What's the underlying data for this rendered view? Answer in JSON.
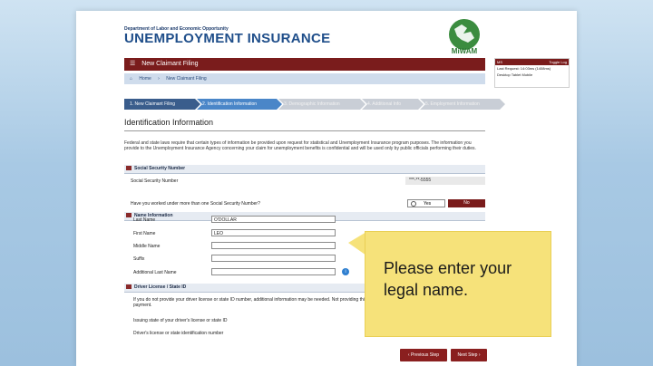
{
  "header": {
    "department": "Department of Labor and Economic Opportunity",
    "title": "UNEMPLOYMENT INSURANCE",
    "logo_text": "MiWAM"
  },
  "filing_bar": {
    "label": "New Claimant Filing"
  },
  "breadcrumb": {
    "home": "Home",
    "current": "New Claimant Filing"
  },
  "steps": [
    {
      "label": "1. New Claimant Filing",
      "state": "done"
    },
    {
      "label": "2. Identification Information",
      "state": "active"
    },
    {
      "label": "3. Demographic Information",
      "state": "todo"
    },
    {
      "label": "4. Additional Info",
      "state": "todo"
    },
    {
      "label": "5. Employment Information",
      "state": "todo"
    }
  ],
  "section_title": "Identification Information",
  "intro": "Federal and state laws require that certain types of information be provided upon request for statistical and Unemployment Insurance program purposes. The information you provide to the Unemployment Insurance Agency concerning your claim for unemployment benefits is confidential and will be used only by public officials performing their duties.",
  "ssn_section": {
    "heading": "Social Security Number",
    "ssn_label": "Social Security Number",
    "ssn_value": "***-**-5555",
    "multi_question": "Have you worked under more than one Social Security Number?",
    "yes_label": "Yes",
    "no_label": "No"
  },
  "name_section": {
    "heading": "Name Information",
    "fields": [
      {
        "label": "Last Name",
        "value": "O'DOLLAR"
      },
      {
        "label": "First Name",
        "value": "LEO"
      },
      {
        "label": "Middle Name",
        "value": ""
      },
      {
        "label": "Suffix",
        "value": ""
      },
      {
        "label": "Additional Last Name",
        "value": ""
      }
    ],
    "info_icon": "i"
  },
  "license_section": {
    "heading": "Driver License / State ID",
    "note": "If you do not provide your driver license or state ID number, additional information may be needed. Not providing this information may delay your benefit payment.",
    "issuing_label": "Issuing state of your driver's license or state ID",
    "number_label": "Driver's license or state identification number"
  },
  "buttons": {
    "previous": "‹ Previous Step",
    "next": "Next Step ›"
  },
  "right_panel": {
    "title": "MS",
    "toggle": "Toggle Log",
    "line1": "Last Request: 14:03ms (1408ms)",
    "line2": "Desktop  Tablet  Mobile"
  },
  "callout": {
    "text": "Please enter your legal name."
  },
  "colors": {
    "maroon": "#7a1c1c",
    "blue_title": "#1f4e8a",
    "callout": "#f6e27a"
  }
}
